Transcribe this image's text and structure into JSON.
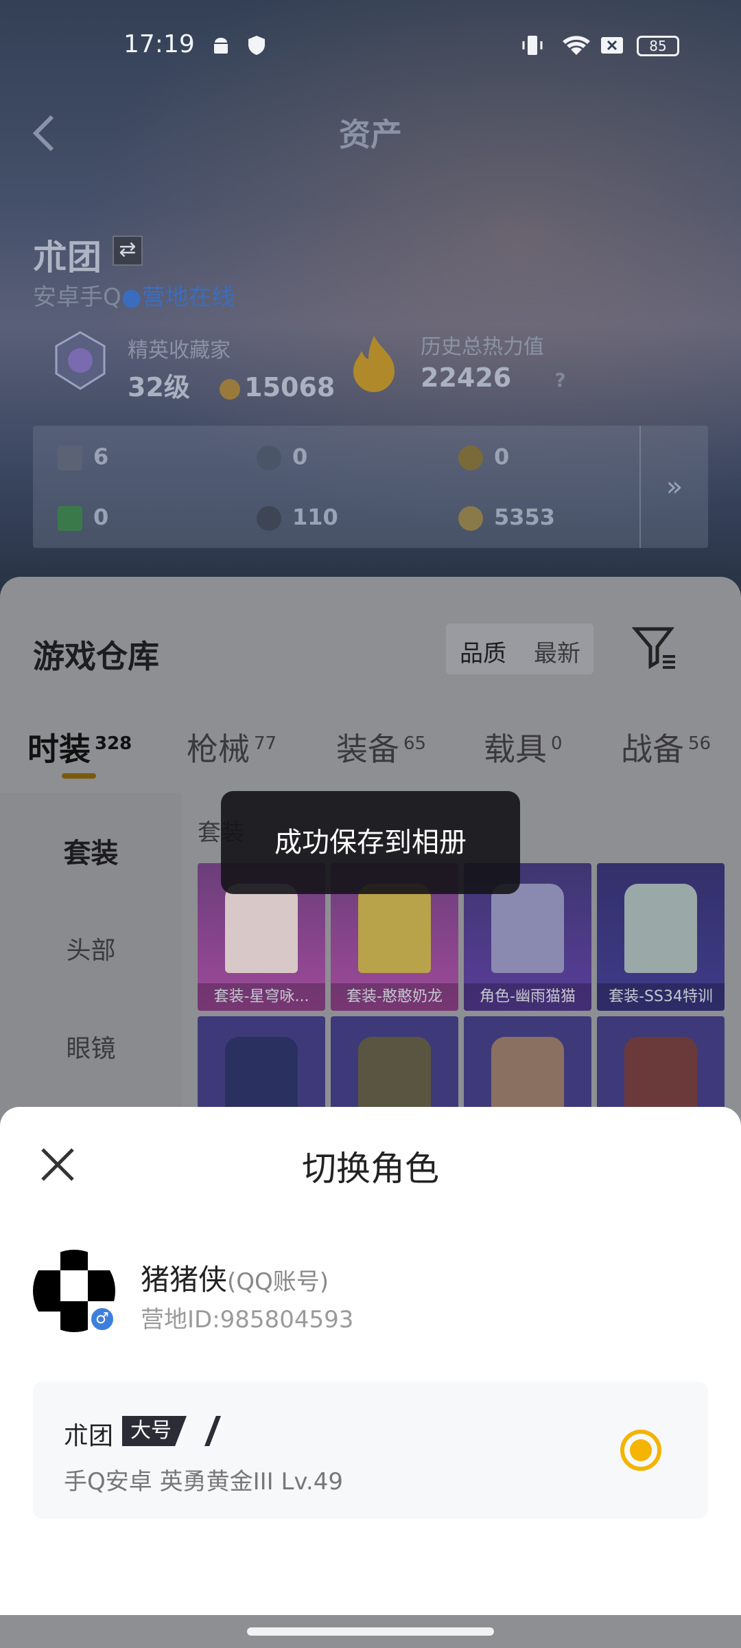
{
  "status_bar": {
    "time": "17:19",
    "battery": "85",
    "icons": [
      "android-icon",
      "app-shield-icon",
      "vibrate-icon",
      "wifi-icon",
      "no-sim-icon",
      "battery-icon"
    ]
  },
  "header": {
    "title": "资产",
    "username": "朮团",
    "platform": "安卓手Q",
    "online_status": "营地在线",
    "collector_label": "精英收藏家",
    "collector_level": "32级",
    "collector_points": "15068",
    "heat_label": "历史总热力值",
    "heat_value": "22426",
    "heat_help": "?"
  },
  "assets": [
    {
      "value": "6",
      "icon": "card-icon"
    },
    {
      "value": "0",
      "icon": "silver-coin-icon"
    },
    {
      "value": "0",
      "icon": "gold-a-coin-icon"
    },
    {
      "value": "0",
      "icon": "green-card-icon"
    },
    {
      "value": "110",
      "icon": "dark-coin-icon"
    },
    {
      "value": "5353",
      "icon": "gold-coin-icon"
    }
  ],
  "warehouse": {
    "title": "游戏仓库",
    "sort_quality": "品质",
    "sort_newest": "最新",
    "categories": [
      {
        "label": "时装",
        "count": "328"
      },
      {
        "label": "枪械",
        "count": "77"
      },
      {
        "label": "装备",
        "count": "65"
      },
      {
        "label": "载具",
        "count": "0"
      },
      {
        "label": "战备",
        "count": "56"
      }
    ],
    "side_items": [
      "套装",
      "头部",
      "眼镜"
    ],
    "content_label": "套装",
    "items": [
      {
        "label": "套装-星穹咏...",
        "color": "#b04a9a"
      },
      {
        "label": "套装-憨憨奶龙",
        "color": "#b04a9a"
      },
      {
        "label": "角色-幽雨猫猫",
        "color": "#5a3e9a"
      },
      {
        "label": "套装-SS34特训",
        "color": "#3e3b8a"
      },
      {
        "label": "",
        "color": "#4a3c8e"
      },
      {
        "label": "",
        "color": "#4a3c8e"
      },
      {
        "label": "",
        "color": "#4a3c8e"
      },
      {
        "label": "",
        "color": "#4a3c8e"
      }
    ]
  },
  "toast": "成功保存到相册",
  "sheet": {
    "title": "切换角色",
    "nickname": "猪猪侠",
    "account_type": "(QQ账号)",
    "camp_id": "营地ID:985804593",
    "role": {
      "name": "朮团",
      "tag": "大号",
      "info": "手Q安卓  英勇黄金III  Lv.49"
    }
  },
  "colors": {
    "accent": "#f4b400",
    "online": "#3a6dc0",
    "sheet_bg": "#ffffff"
  }
}
